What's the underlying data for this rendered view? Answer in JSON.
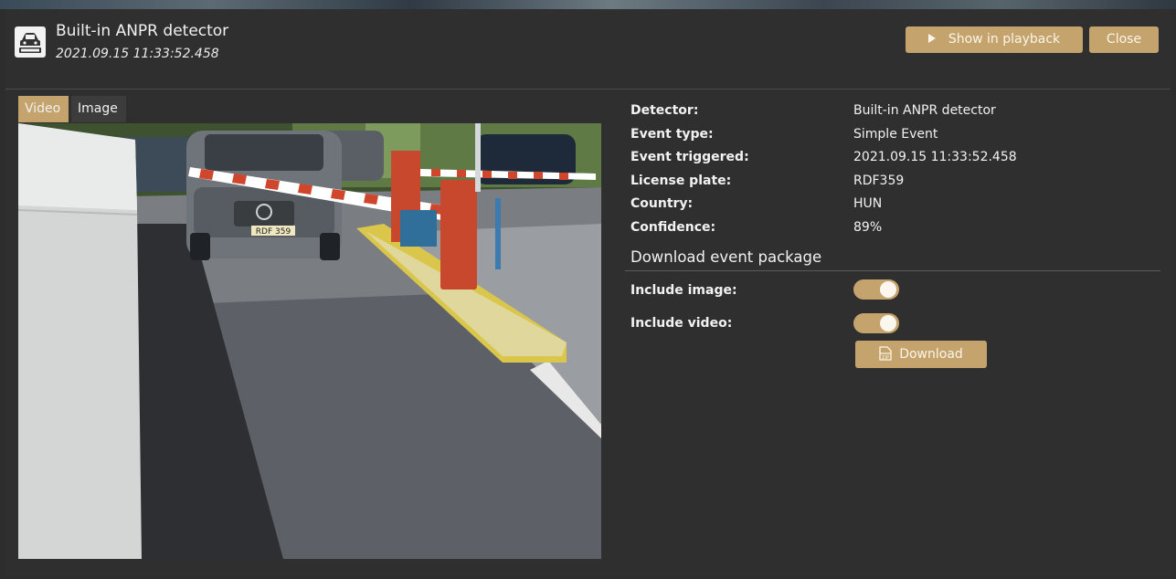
{
  "header": {
    "title": "Built-in ANPR detector",
    "subtitle": "2021.09.15 11:33:52.458",
    "app_icon": "car-plate-icon",
    "playback_label": "Show in playback",
    "close_label": "Close"
  },
  "tabs": [
    {
      "label": "Video",
      "active": true
    },
    {
      "label": "Image",
      "active": false
    }
  ],
  "media": {
    "plate_text": "RDF 359"
  },
  "details": [
    {
      "label": "Detector:",
      "value": "Built-in ANPR detector"
    },
    {
      "label": "Event type:",
      "value": "Simple Event"
    },
    {
      "label": "Event triggered:",
      "value": "2021.09.15 11:33:52.458"
    },
    {
      "label": "License plate:",
      "value": "RDF359"
    },
    {
      "label": "Country:",
      "value": "HUN"
    },
    {
      "label": "Confidence:",
      "value": "89%"
    }
  ],
  "download": {
    "section_title": "Download event package",
    "include_image_label": "Include image:",
    "include_image_on": true,
    "include_video_label": "Include video:",
    "include_video_on": true,
    "download_label": "Download",
    "download_icon": "zip-icon"
  },
  "colors": {
    "accent": "#c4a46c",
    "background": "#2f2f2f"
  }
}
